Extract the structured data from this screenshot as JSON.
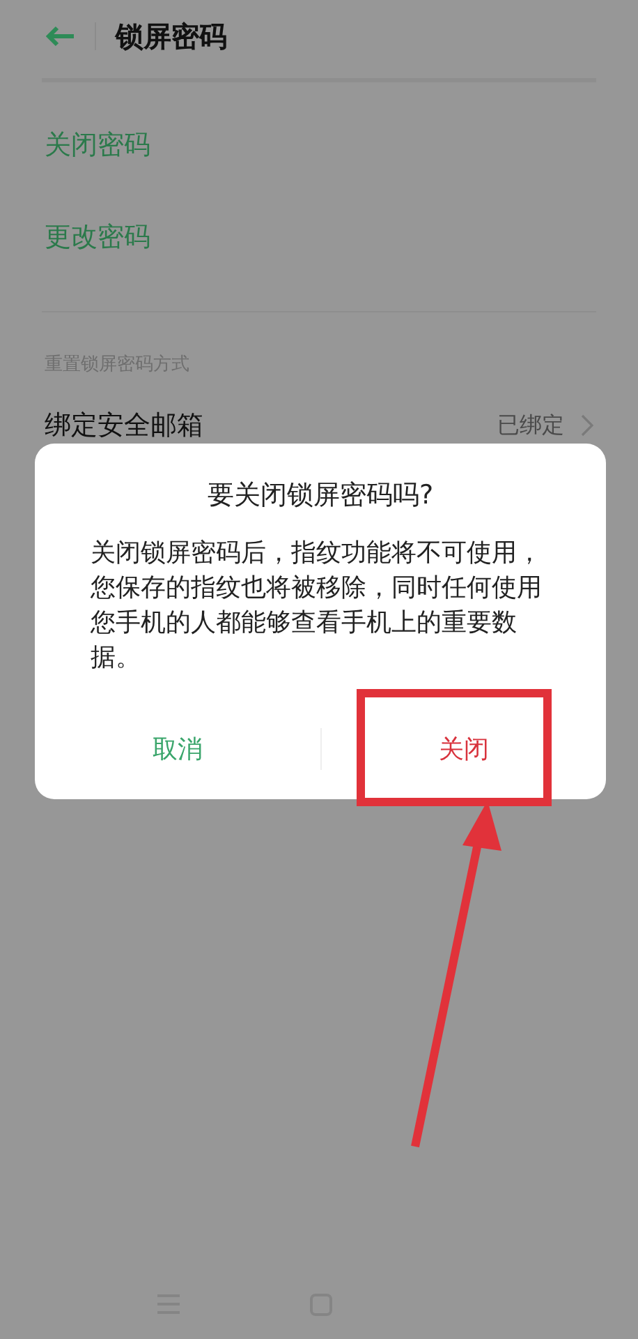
{
  "header": {
    "title": "锁屏密码"
  },
  "actions": [
    "关闭密码",
    "更改密码"
  ],
  "section": {
    "title": "重置锁屏密码方式"
  },
  "rows": [
    {
      "label": "绑定安全邮箱",
      "value": "已绑定"
    }
  ],
  "dialog": {
    "title": "要关闭锁屏密码吗?",
    "message": "关闭锁屏密码后，指纹功能将不可使用，您保存的指纹也将被移除，同时任何使用您手机的人都能够查看手机上的重要数据。",
    "buttons": [
      {
        "label": "取消",
        "kind": "cancel"
      },
      {
        "label": "关闭",
        "kind": "confirm"
      }
    ]
  }
}
